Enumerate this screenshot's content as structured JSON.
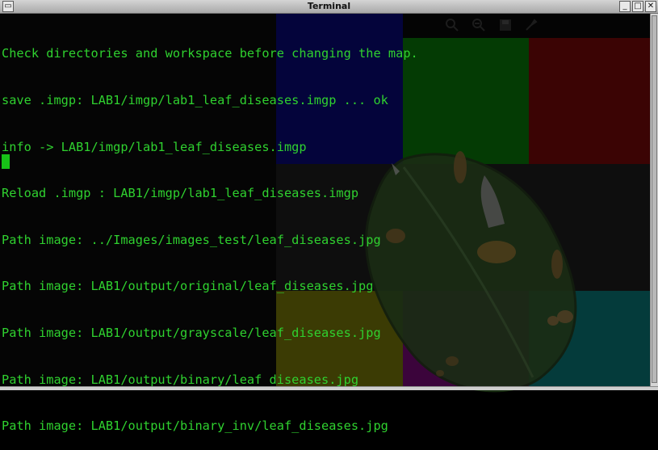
{
  "window": {
    "title": "Terminal",
    "menu_glyph": "▭",
    "minimize_glyph": "_",
    "maximize_glyph": "□",
    "close_glyph": "✕"
  },
  "terminal": {
    "lines": [
      "Check directories and workspace before changing the map.",
      "save .imgp: LAB1/imgp/lab1_leaf_diseases.imgp ... ok",
      "info -> LAB1/imgp/lab1_leaf_diseases.imgp",
      "Reload .imgp : LAB1/imgp/lab1_leaf_diseases.imgp",
      "Path image: ../Images/images_test/leaf_diseases.jpg",
      "Path image: LAB1/output/original/leaf_diseases.jpg",
      "Path image: LAB1/output/grayscale/leaf_diseases.jpg",
      "Path image: LAB1/output/binary/leaf_diseases.jpg",
      "Path image: LAB1/output/binary_inv/leaf_diseases.jpg"
    ],
    "text_color": "#2fd12f",
    "cursor_color": "#17c217"
  },
  "background_app": {
    "toolbar_icons": [
      "zoom-in-icon",
      "zoom-out-icon",
      "save-icon",
      "pin-icon"
    ],
    "tiles": [
      {
        "name": "tile-blue",
        "color": "#000066"
      },
      {
        "name": "tile-green",
        "color": "#006600"
      },
      {
        "name": "tile-red",
        "color": "#660000"
      },
      {
        "name": "tile-gray",
        "color": "#141414"
      },
      {
        "name": "tile-yellow",
        "color": "#666600"
      },
      {
        "name": "tile-purple",
        "color": "#660066"
      },
      {
        "name": "tile-cyan",
        "color": "#006666"
      }
    ]
  }
}
